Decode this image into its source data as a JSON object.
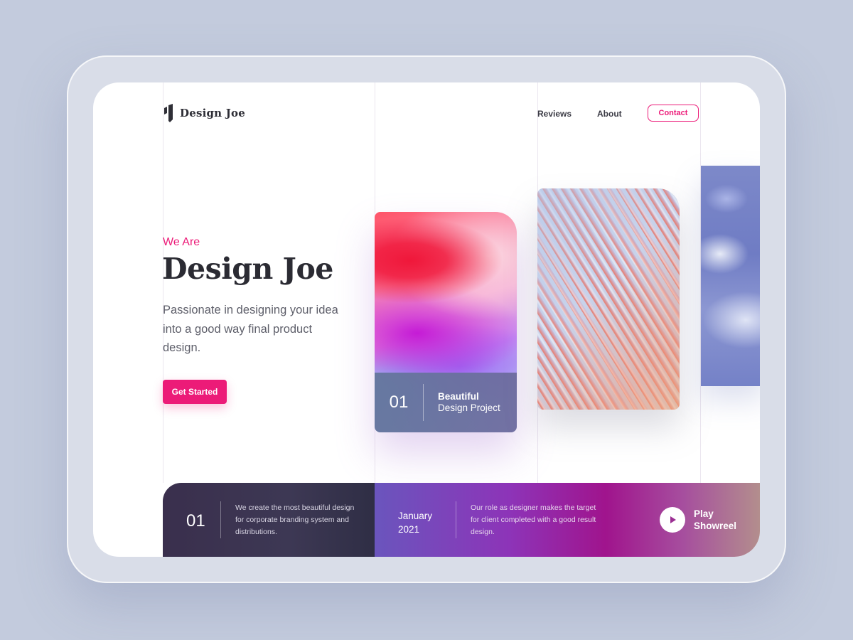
{
  "brand": {
    "name": "Design Joe"
  },
  "nav": {
    "reviews": "Reviews",
    "about": "About",
    "contact": "Contact"
  },
  "hero": {
    "eyebrow": "We Are",
    "title": "Design Joe",
    "description": "Passionate in designing your idea into a good way final product design.",
    "cta": "Get Started"
  },
  "projects": [
    {
      "number": "01",
      "title": "Beautiful",
      "subtitle": "Design Project"
    }
  ],
  "footer": {
    "number": "01",
    "text": "We create the most beautiful design for corporate branding system and distributions.",
    "date_month": "January",
    "date_year": "2021",
    "role_text": "Our role as designer makes the target for client completed with a good result design.",
    "play_line1": "Play",
    "play_line2": "Showreel"
  },
  "colors": {
    "accent": "#ec1b78",
    "dark": "#2b2b33"
  },
  "icons": {
    "logo": "logo-mark-icon",
    "play": "play-icon"
  }
}
